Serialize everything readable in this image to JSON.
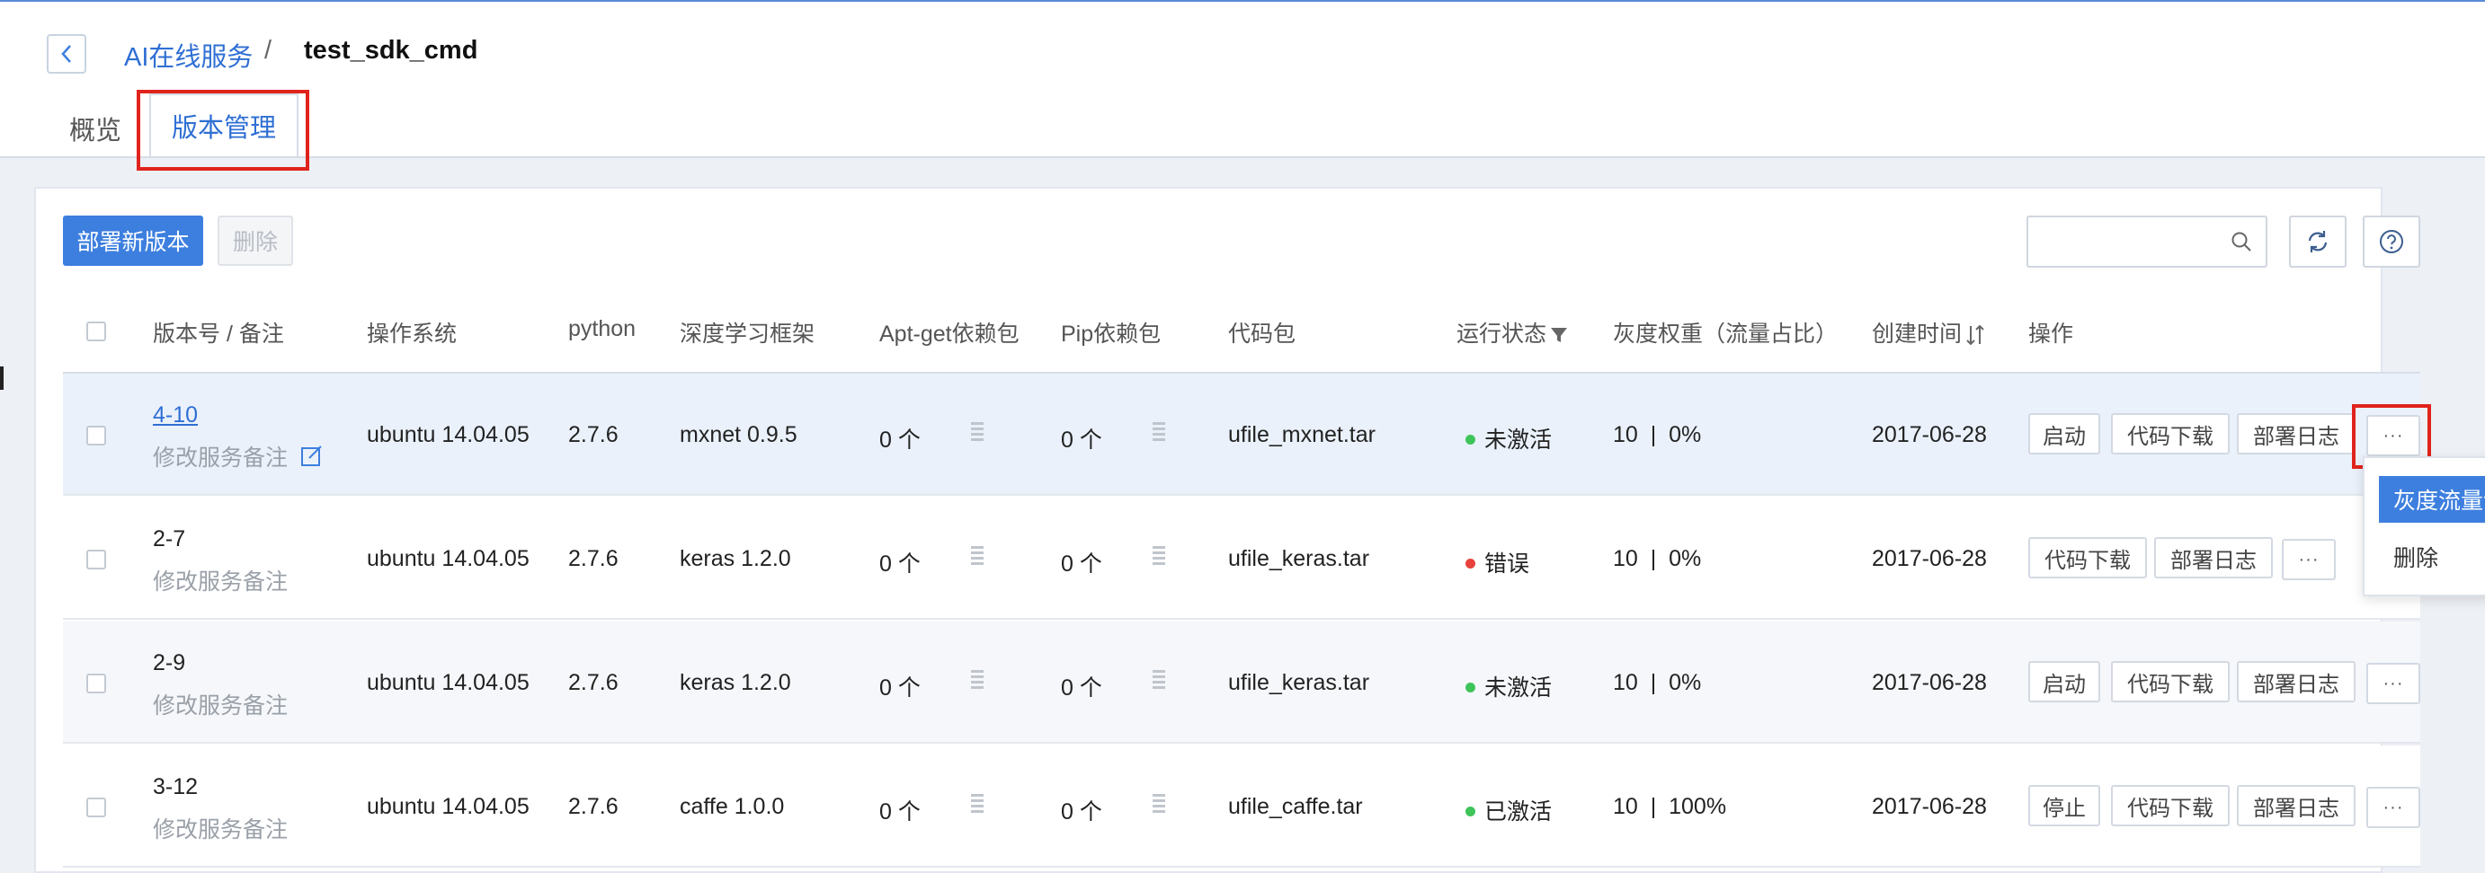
{
  "breadcrumb": {
    "parent": "AI在线服务",
    "separator": "/",
    "current": "test_sdk_cmd"
  },
  "tabs": [
    {
      "label": "概览",
      "active": false
    },
    {
      "label": "版本管理",
      "active": true
    }
  ],
  "toolbar": {
    "deploy_label": "部署新版本",
    "delete_label": "删除",
    "search_placeholder": ""
  },
  "table": {
    "headers": [
      "版本号 / 备注",
      "操作系统",
      "python",
      "深度学习框架",
      "Apt-get依赖包",
      "Pip依赖包",
      "代码包",
      "运行状态",
      "灰度权重（流量占比）",
      "创建时间",
      "操作"
    ],
    "rows": [
      {
        "version": "4-10",
        "note": "修改服务备注",
        "os": "ubuntu 14.04.05",
        "python": "2.7.6",
        "framework": "mxnet 0.9.5",
        "apt": "0 个",
        "pip": "0 个",
        "code": "ufile_mxnet.tar",
        "status": "未激活",
        "status_color": "#3fc45a",
        "weight": "10",
        "ratio": "0%",
        "created": "2017-06-28",
        "actions": [
          "启动",
          "代码下载",
          "部署日志"
        ]
      },
      {
        "version": "2-7",
        "note": "修改服务备注",
        "os": "ubuntu 14.04.05",
        "python": "2.7.6",
        "framework": "keras 1.2.0",
        "apt": "0 个",
        "pip": "0 个",
        "code": "ufile_keras.tar",
        "status": "错误",
        "status_color": "#e8413b",
        "weight": "10",
        "ratio": "0%",
        "created": "2017-06-28",
        "actions": [
          "代码下载",
          "部署日志"
        ]
      },
      {
        "version": "2-9",
        "note": "修改服务备注",
        "os": "ubuntu 14.04.05",
        "python": "2.7.6",
        "framework": "keras 1.2.0",
        "apt": "0 个",
        "pip": "0 个",
        "code": "ufile_keras.tar",
        "status": "未激活",
        "status_color": "#3fc45a",
        "weight": "10",
        "ratio": "0%",
        "created": "2017-06-28",
        "actions": [
          "启动",
          "代码下载",
          "部署日志"
        ]
      },
      {
        "version": "3-12",
        "note": "修改服务备注",
        "os": "ubuntu 14.04.05",
        "python": "2.7.6",
        "framework": "caffe 1.0.0",
        "apt": "0 个",
        "pip": "0 个",
        "code": "ufile_caffe.tar",
        "status": "已激活",
        "status_color": "#3fc45a",
        "weight": "10",
        "ratio": "100%",
        "created": "2017-06-28",
        "actions": [
          "停止",
          "代码下载",
          "部署日志"
        ]
      }
    ]
  },
  "more_label": "···",
  "weight_sep": "|",
  "dropdown": {
    "items": [
      "灰度流量设置",
      "删除"
    ]
  },
  "colors": {
    "accent": "#3d7fdf",
    "link": "#2f6fd4",
    "highlight_box": "#e0231b"
  }
}
